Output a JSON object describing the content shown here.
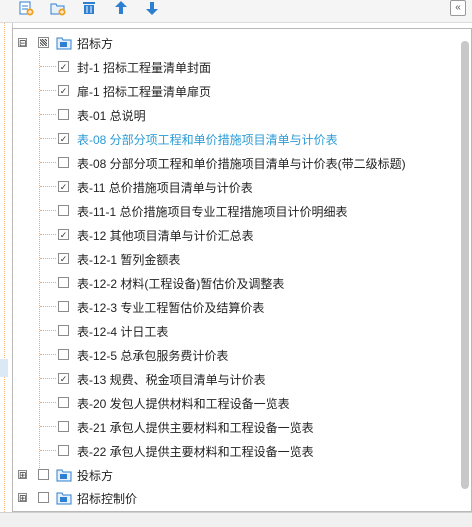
{
  "toolbar": {
    "buttons": [
      {
        "icon": "add-item-icon"
      },
      {
        "icon": "add-folder-icon"
      },
      {
        "icon": "delete-icon"
      },
      {
        "icon": "move-up-icon"
      },
      {
        "icon": "move-down-icon"
      }
    ],
    "collapse_label": "«"
  },
  "colors": {
    "accent": "#2a9bd6",
    "tree_line": "#f2a65c",
    "icon_blue": "#2f7fd0"
  },
  "tree": {
    "root": {
      "label": "招标方",
      "expanded_symbol": "⊟",
      "checked": "partial"
    },
    "items": [
      {
        "label": "封-1 招标工程量清单封面",
        "checked": true,
        "active": false
      },
      {
        "label": "扉-1 招标工程量清单扉页",
        "checked": true,
        "active": false
      },
      {
        "label": "表-01 总说明",
        "checked": false,
        "active": false
      },
      {
        "label": "表-08 分部分项工程和单价措施项目清单与计价表",
        "checked": true,
        "active": true
      },
      {
        "label": "表-08 分部分项工程和单价措施项目清单与计价表(带二级标题)",
        "checked": false,
        "active": false
      },
      {
        "label": "表-11 总价措施项目清单与计价表",
        "checked": true,
        "active": false
      },
      {
        "label": "表-11-1 总价措施项目专业工程措施项目计价明细表",
        "checked": false,
        "active": false
      },
      {
        "label": "表-12 其他项目清单与计价汇总表",
        "checked": true,
        "active": false
      },
      {
        "label": "表-12-1 暂列金额表",
        "checked": true,
        "active": false
      },
      {
        "label": "表-12-2 材料(工程设备)暂估价及调整表",
        "checked": false,
        "active": false
      },
      {
        "label": "表-12-3 专业工程暂估价及结算价表",
        "checked": false,
        "active": false
      },
      {
        "label": "表-12-4 计日工表",
        "checked": false,
        "active": false
      },
      {
        "label": "表-12-5 总承包服务费计价表",
        "checked": false,
        "active": false
      },
      {
        "label": "表-13 规费、税金项目清单与计价表",
        "checked": true,
        "active": false
      },
      {
        "label": "表-20 发包人提供材料和工程设备一览表",
        "checked": false,
        "active": false
      },
      {
        "label": "表-21 承包人提供主要材料和工程设备一览表",
        "checked": false,
        "active": false
      },
      {
        "label": "表-22 承包人提供主要材料和工程设备一览表",
        "checked": false,
        "active": false
      }
    ],
    "groups": [
      {
        "label": "投标方",
        "expand_symbol": "⊞",
        "checked": false
      },
      {
        "label": "招标控制价",
        "expand_symbol": "⊞",
        "checked": false
      }
    ]
  }
}
